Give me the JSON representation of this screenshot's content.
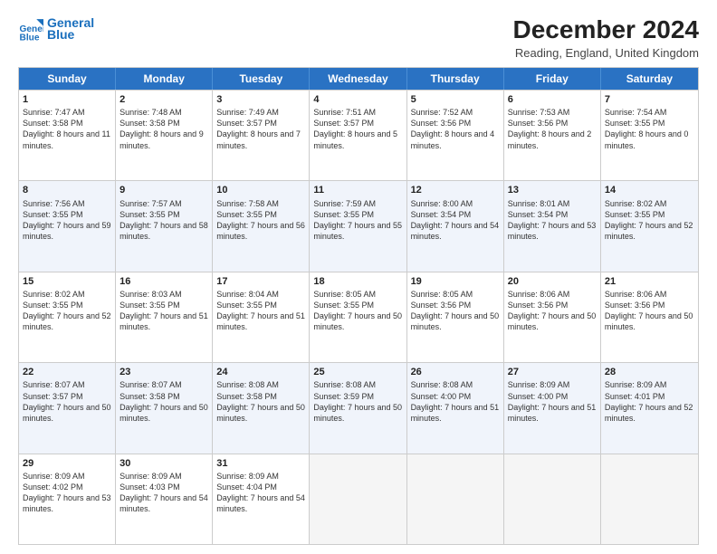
{
  "header": {
    "logo_line1": "General",
    "logo_line2": "Blue",
    "main_title": "December 2024",
    "subtitle": "Reading, England, United Kingdom"
  },
  "days": [
    "Sunday",
    "Monday",
    "Tuesday",
    "Wednesday",
    "Thursday",
    "Friday",
    "Saturday"
  ],
  "rows": [
    [
      {
        "day": 1,
        "sunrise": "Sunrise: 7:47 AM",
        "sunset": "Sunset: 3:58 PM",
        "daylight": "Daylight: 8 hours and 11 minutes."
      },
      {
        "day": 2,
        "sunrise": "Sunrise: 7:48 AM",
        "sunset": "Sunset: 3:58 PM",
        "daylight": "Daylight: 8 hours and 9 minutes."
      },
      {
        "day": 3,
        "sunrise": "Sunrise: 7:49 AM",
        "sunset": "Sunset: 3:57 PM",
        "daylight": "Daylight: 8 hours and 7 minutes."
      },
      {
        "day": 4,
        "sunrise": "Sunrise: 7:51 AM",
        "sunset": "Sunset: 3:57 PM",
        "daylight": "Daylight: 8 hours and 5 minutes."
      },
      {
        "day": 5,
        "sunrise": "Sunrise: 7:52 AM",
        "sunset": "Sunset: 3:56 PM",
        "daylight": "Daylight: 8 hours and 4 minutes."
      },
      {
        "day": 6,
        "sunrise": "Sunrise: 7:53 AM",
        "sunset": "Sunset: 3:56 PM",
        "daylight": "Daylight: 8 hours and 2 minutes."
      },
      {
        "day": 7,
        "sunrise": "Sunrise: 7:54 AM",
        "sunset": "Sunset: 3:55 PM",
        "daylight": "Daylight: 8 hours and 0 minutes."
      }
    ],
    [
      {
        "day": 8,
        "sunrise": "Sunrise: 7:56 AM",
        "sunset": "Sunset: 3:55 PM",
        "daylight": "Daylight: 7 hours and 59 minutes."
      },
      {
        "day": 9,
        "sunrise": "Sunrise: 7:57 AM",
        "sunset": "Sunset: 3:55 PM",
        "daylight": "Daylight: 7 hours and 58 minutes."
      },
      {
        "day": 10,
        "sunrise": "Sunrise: 7:58 AM",
        "sunset": "Sunset: 3:55 PM",
        "daylight": "Daylight: 7 hours and 56 minutes."
      },
      {
        "day": 11,
        "sunrise": "Sunrise: 7:59 AM",
        "sunset": "Sunset: 3:55 PM",
        "daylight": "Daylight: 7 hours and 55 minutes."
      },
      {
        "day": 12,
        "sunrise": "Sunrise: 8:00 AM",
        "sunset": "Sunset: 3:54 PM",
        "daylight": "Daylight: 7 hours and 54 minutes."
      },
      {
        "day": 13,
        "sunrise": "Sunrise: 8:01 AM",
        "sunset": "Sunset: 3:54 PM",
        "daylight": "Daylight: 7 hours and 53 minutes."
      },
      {
        "day": 14,
        "sunrise": "Sunrise: 8:02 AM",
        "sunset": "Sunset: 3:55 PM",
        "daylight": "Daylight: 7 hours and 52 minutes."
      }
    ],
    [
      {
        "day": 15,
        "sunrise": "Sunrise: 8:02 AM",
        "sunset": "Sunset: 3:55 PM",
        "daylight": "Daylight: 7 hours and 52 minutes."
      },
      {
        "day": 16,
        "sunrise": "Sunrise: 8:03 AM",
        "sunset": "Sunset: 3:55 PM",
        "daylight": "Daylight: 7 hours and 51 minutes."
      },
      {
        "day": 17,
        "sunrise": "Sunrise: 8:04 AM",
        "sunset": "Sunset: 3:55 PM",
        "daylight": "Daylight: 7 hours and 51 minutes."
      },
      {
        "day": 18,
        "sunrise": "Sunrise: 8:05 AM",
        "sunset": "Sunset: 3:55 PM",
        "daylight": "Daylight: 7 hours and 50 minutes."
      },
      {
        "day": 19,
        "sunrise": "Sunrise: 8:05 AM",
        "sunset": "Sunset: 3:56 PM",
        "daylight": "Daylight: 7 hours and 50 minutes."
      },
      {
        "day": 20,
        "sunrise": "Sunrise: 8:06 AM",
        "sunset": "Sunset: 3:56 PM",
        "daylight": "Daylight: 7 hours and 50 minutes."
      },
      {
        "day": 21,
        "sunrise": "Sunrise: 8:06 AM",
        "sunset": "Sunset: 3:56 PM",
        "daylight": "Daylight: 7 hours and 50 minutes."
      }
    ],
    [
      {
        "day": 22,
        "sunrise": "Sunrise: 8:07 AM",
        "sunset": "Sunset: 3:57 PM",
        "daylight": "Daylight: 7 hours and 50 minutes."
      },
      {
        "day": 23,
        "sunrise": "Sunrise: 8:07 AM",
        "sunset": "Sunset: 3:58 PM",
        "daylight": "Daylight: 7 hours and 50 minutes."
      },
      {
        "day": 24,
        "sunrise": "Sunrise: 8:08 AM",
        "sunset": "Sunset: 3:58 PM",
        "daylight": "Daylight: 7 hours and 50 minutes."
      },
      {
        "day": 25,
        "sunrise": "Sunrise: 8:08 AM",
        "sunset": "Sunset: 3:59 PM",
        "daylight": "Daylight: 7 hours and 50 minutes."
      },
      {
        "day": 26,
        "sunrise": "Sunrise: 8:08 AM",
        "sunset": "Sunset: 4:00 PM",
        "daylight": "Daylight: 7 hours and 51 minutes."
      },
      {
        "day": 27,
        "sunrise": "Sunrise: 8:09 AM",
        "sunset": "Sunset: 4:00 PM",
        "daylight": "Daylight: 7 hours and 51 minutes."
      },
      {
        "day": 28,
        "sunrise": "Sunrise: 8:09 AM",
        "sunset": "Sunset: 4:01 PM",
        "daylight": "Daylight: 7 hours and 52 minutes."
      }
    ],
    [
      {
        "day": 29,
        "sunrise": "Sunrise: 8:09 AM",
        "sunset": "Sunset: 4:02 PM",
        "daylight": "Daylight: 7 hours and 53 minutes."
      },
      {
        "day": 30,
        "sunrise": "Sunrise: 8:09 AM",
        "sunset": "Sunset: 4:03 PM",
        "daylight": "Daylight: 7 hours and 54 minutes."
      },
      {
        "day": 31,
        "sunrise": "Sunrise: 8:09 AM",
        "sunset": "Sunset: 4:04 PM",
        "daylight": "Daylight: 7 hours and 54 minutes."
      },
      null,
      null,
      null,
      null
    ]
  ]
}
